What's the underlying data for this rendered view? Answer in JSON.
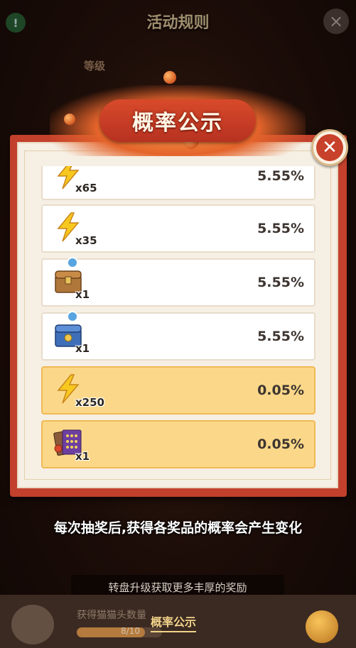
{
  "background": {
    "title": "活动规则",
    "level_label": "等级"
  },
  "modal": {
    "title": "概率公示",
    "close_icon": "close-x-icon",
    "items": [
      {
        "icon": "lightning-bolt-icon",
        "qty": "x65",
        "probability": "5.55%",
        "highlight": false
      },
      {
        "icon": "lightning-bolt-icon",
        "qty": "x35",
        "probability": "5.55%",
        "highlight": false
      },
      {
        "icon": "treasure-chest-icon",
        "qty": "x1",
        "probability": "5.55%",
        "highlight": false
      },
      {
        "icon": "blue-chest-icon",
        "qty": "x1",
        "probability": "5.55%",
        "highlight": false
      },
      {
        "icon": "lightning-bolt-icon",
        "qty": "x250",
        "probability": "0.05%",
        "highlight": true
      },
      {
        "icon": "card-pack-icon",
        "qty": "x1",
        "probability": "0.05%",
        "highlight": true
      }
    ]
  },
  "notice": "每次抽奖后,获得各奖品的概率会产生变化",
  "upgrade_hint": "转盘升级获取更多丰厚的奖励",
  "bottom": {
    "collect_label": "获得猫猫头数量",
    "progress_text": "8/10",
    "progress_fraction": 0.8,
    "tab_label": "概率公示"
  },
  "colors": {
    "frame_red": "#c2402c",
    "highlight_gold": "#fbd889",
    "bolt_yellow": "#f7c81e"
  }
}
